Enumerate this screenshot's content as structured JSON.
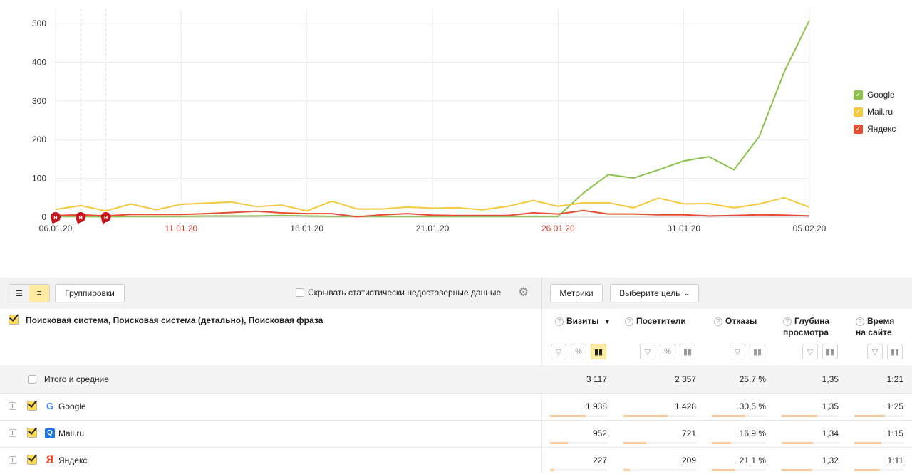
{
  "chart_data": {
    "type": "line",
    "x": [
      "06.01.20",
      "07.01.20",
      "08.01.20",
      "09.01.20",
      "10.01.20",
      "11.01.20",
      "12.01.20",
      "13.01.20",
      "14.01.20",
      "15.01.20",
      "16.01.20",
      "17.01.20",
      "18.01.20",
      "19.01.20",
      "20.01.20",
      "21.01.20",
      "22.01.20",
      "23.01.20",
      "24.01.20",
      "25.01.20",
      "26.01.20",
      "27.01.20",
      "28.01.20",
      "29.01.20",
      "30.01.20",
      "31.01.20",
      "01.02.20",
      "02.02.20",
      "03.02.20",
      "04.02.20",
      "05.02.20"
    ],
    "x_tick_labels": [
      "06.01.20",
      "11.01.20",
      "16.01.20",
      "21.01.20",
      "26.01.20",
      "31.01.20",
      "05.02.20"
    ],
    "x_tick_red": [
      false,
      true,
      false,
      false,
      true,
      false,
      false
    ],
    "y_ticks": [
      "0",
      "100",
      "200",
      "300",
      "400",
      "500"
    ],
    "ylim": [
      0,
      520
    ],
    "grid": true,
    "legend": "right",
    "series": [
      {
        "name": "Google",
        "color": "#8bc34a",
        "values": [
          2,
          2,
          1,
          2,
          2,
          2,
          3,
          3,
          3,
          4,
          3,
          2,
          2,
          2,
          2,
          2,
          2,
          2,
          2,
          2,
          2,
          62,
          110,
          101,
          122,
          145,
          156,
          122,
          208,
          375,
          508
        ]
      },
      {
        "name": "Mail.ru",
        "color": "#f4c93e",
        "values": [
          20,
          30,
          16,
          34,
          19,
          33,
          36,
          39,
          27,
          31,
          16,
          41,
          21,
          21,
          26,
          23,
          24,
          19,
          28,
          43,
          28,
          37,
          37,
          24,
          49,
          34,
          35,
          24,
          34,
          50,
          26
        ]
      },
      {
        "name": "Яндекс",
        "color": "#e84d30",
        "values": [
          4,
          6,
          3,
          7,
          7,
          7,
          9,
          12,
          15,
          11,
          9,
          9,
          1,
          6,
          9,
          5,
          4,
          4,
          4,
          11,
          8,
          17,
          8,
          8,
          6,
          6,
          3,
          4,
          6,
          5,
          3
        ]
      }
    ],
    "markers": [
      "н",
      "н",
      "н"
    ]
  },
  "toolbar": {
    "groupings_label": "Группировки",
    "hide_label": "Скрывать статистически недостоверные данные",
    "metrics_label": "Метрики",
    "goal_label": "Выберите цель"
  },
  "table": {
    "dimension_title": "Поисковая система, Поисковая система (детально), Поисковая фраза",
    "columns": [
      {
        "label": "Визиты",
        "sort": "▼"
      },
      {
        "label": "Посетители"
      },
      {
        "label": "Отказы"
      },
      {
        "label": "Глубина просмотра"
      },
      {
        "label": "Время на сайте"
      }
    ],
    "total": {
      "label": "Итого и средние",
      "values": [
        "3 117",
        "2 357",
        "25,7 %",
        "1,35",
        "1:21"
      ]
    },
    "rows": [
      {
        "label": "Google",
        "icon": "google-icon",
        "values": [
          "1 938",
          "1 428",
          "30,5 %",
          "1,35",
          "1:25"
        ],
        "bars": [
          0.62,
          0.61,
          0.62,
          0.62,
          0.62
        ]
      },
      {
        "label": "Mail.ru",
        "icon": "mailru-icon",
        "values": [
          "952",
          "721",
          "16,9 %",
          "1,34",
          "1:15"
        ],
        "bars": [
          0.31,
          0.31,
          0.35,
          0.55,
          0.55
        ]
      },
      {
        "label": "Яндекс",
        "icon": "yandex-icon",
        "values": [
          "227",
          "209",
          "21,1 %",
          "1,32",
          "1:11"
        ],
        "bars": [
          0.07,
          0.09,
          0.43,
          0.54,
          0.52
        ]
      }
    ]
  },
  "colors": {
    "accent": "#ffdb4d",
    "bar": "#f8c99b",
    "marker": "#c4161c"
  }
}
